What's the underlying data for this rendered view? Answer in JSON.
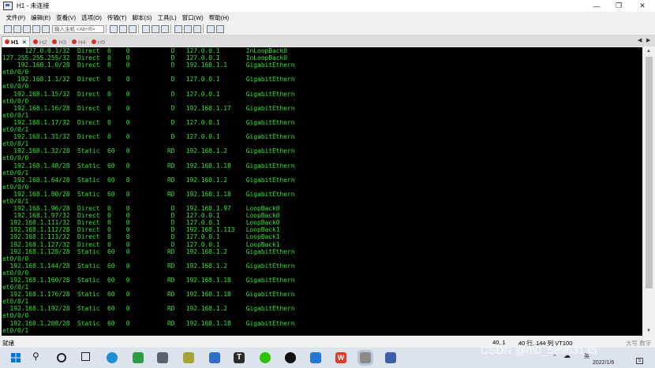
{
  "window": {
    "title": "H1 - 未连接"
  },
  "menu": [
    "文件(F)",
    "编辑(E)",
    "查看(V)",
    "选项(O)",
    "传输(T)",
    "脚本(S)",
    "工具(L)",
    "窗口(W)",
    "帮助(H)"
  ],
  "toolbar": {
    "host_placeholder": "输入主机 <Alt+R>"
  },
  "tabs": [
    {
      "label": "H1",
      "active": true
    },
    {
      "label": "H2",
      "active": false
    },
    {
      "label": "H3",
      "active": false
    },
    {
      "label": "H4",
      "active": false
    },
    {
      "label": "H5",
      "active": false
    }
  ],
  "terminal": {
    "color": "#32e632",
    "lines": [
      "      127.0.0.1/32  Direct  0    0           D   127.0.0.1       InLoopBack0",
      "127.255.255.255/32  Direct  0    0           D   127.0.0.1       InLoopBack0",
      "    192.168.1.0/28  Direct  0    0           D   192.168.1.1     GigabitEthern",
      "et0/0/0",
      "    192.168.1.1/32  Direct  0    0           D   127.0.0.1       GigabitEthern",
      "et0/0/0",
      "   192.168.1.15/32  Direct  0    0           D   127.0.0.1       GigabitEthern",
      "et0/0/0",
      "   192.168.1.16/28  Direct  0    0           D   192.168.1.17    GigabitEthern",
      "et0/0/1",
      "   192.168.1.17/32  Direct  0    0           D   127.0.0.1       GigabitEthern",
      "et0/0/1",
      "   192.168.1.31/32  Direct  0    0           D   127.0.0.1       GigabitEthern",
      "et0/0/1",
      "   192.168.1.32/28  Static  60   0          RD   192.168.1.2     GigabitEthern",
      "et0/0/0",
      "   192.168.1.48/28  Static  60   0          RD   192.168.1.18    GigabitEthern",
      "et0/0/1",
      "   192.168.1.64/28  Static  60   0          RD   192.168.1.2     GigabitEthern",
      "et0/0/0",
      "   192.168.1.80/28  Static  60   0          RD   192.168.1.18    GigabitEthern",
      "et0/0/1",
      "   192.168.1.96/28  Direct  0    0           D   192.168.1.97    LoopBack0",
      "   192.168.1.97/32  Direct  0    0           D   127.0.0.1       LoopBack0",
      "  192.168.1.111/32  Direct  0    0           D   127.0.0.1       LoopBack0",
      "  192.168.1.112/28  Direct  0    0           D   192.168.1.113   LoopBack1",
      "  192.168.1.113/32  Direct  0    0           D   127.0.0.1       LoopBack1",
      "  192.168.1.127/32  Direct  0    0           D   127.0.0.1       LoopBack1",
      "  192.168.1.128/28  Static  60   0          RD   192.168.1.2     GigabitEthern",
      "et0/0/0",
      "  192.168.1.144/28  Static  60   0          RD   192.168.1.2     GigabitEthern",
      "et0/0/0",
      "  192.168.1.160/28  Static  60   0          RD   192.168.1.18    GigabitEthern",
      "et0/0/1",
      "  192.168.1.176/28  Static  60   0          RD   192.168.1.18    GigabitEthern",
      "et0/0/1",
      "  192.168.1.192/28  Static  60   0          RD   192.168.1.2     GigabitEthern",
      "et0/0/0",
      "  192.168.1.208/28  Static  60   0          RD   192.168.1.18    GigabitEthern",
      "et0/0/1"
    ]
  },
  "status": {
    "left": "就绪",
    "position": "40,  1",
    "info": "40 行, 144 列 VT100",
    "right": "大写 数字"
  },
  "taskbar": {
    "time": "",
    "date": "2022/1/6",
    "notification": "5"
  },
  "watermark": "CSDN @m0_58963135"
}
